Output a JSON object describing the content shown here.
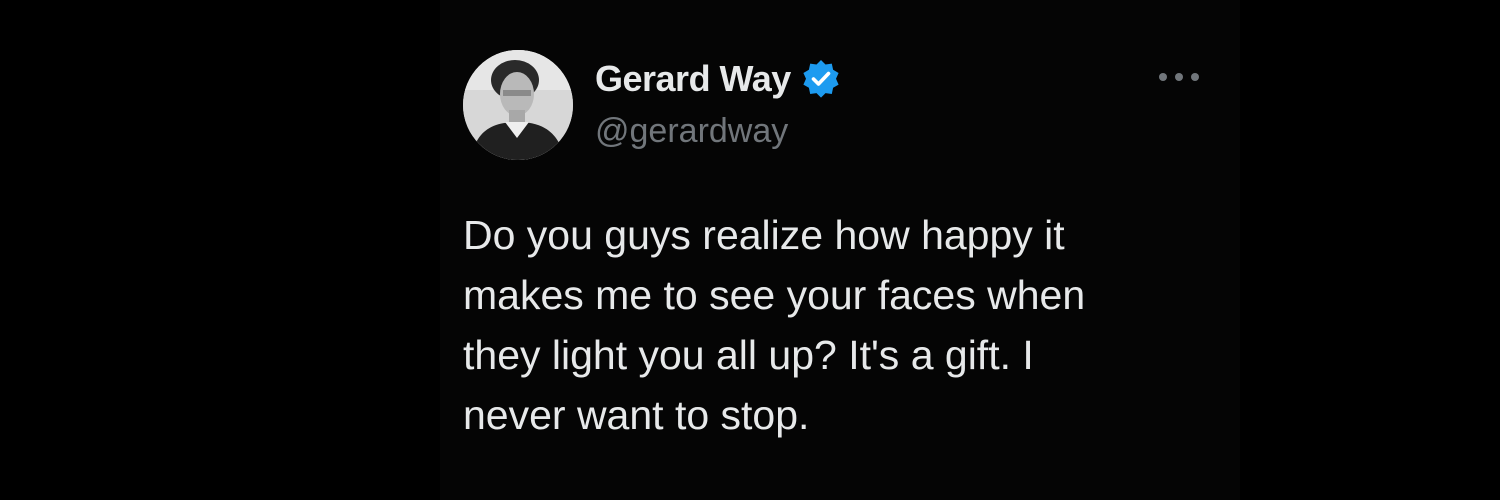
{
  "tweet": {
    "author": {
      "display_name": "Gerard Way",
      "handle": "@gerardway",
      "verified": true,
      "verified_color": "#1d9bf0",
      "avatar_icon": "profile-photo"
    },
    "more_icon": "ellipsis-icon",
    "text_lines": [
      "Do you guys realize how happy it",
      "makes me to see your faces when",
      "they light you all up? It's a gift. I",
      "never want to stop."
    ]
  },
  "colors": {
    "background": "#000000",
    "card": "#050505",
    "primary_text": "#e7e9ea",
    "secondary_text": "#71767b",
    "accent": "#1d9bf0"
  }
}
